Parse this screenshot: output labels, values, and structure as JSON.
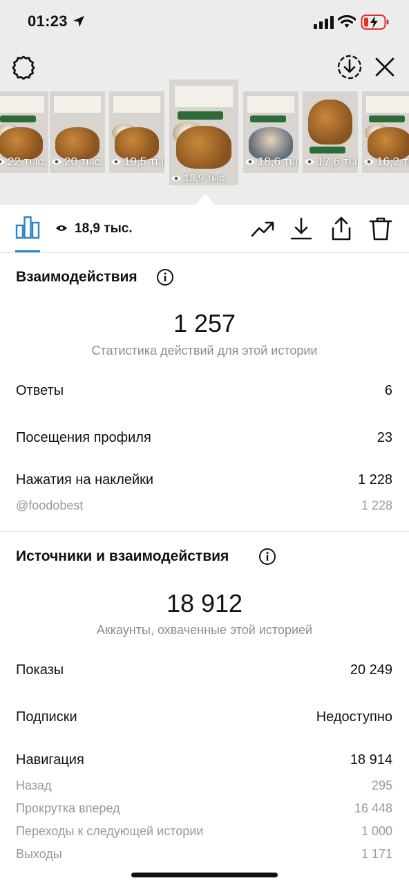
{
  "status_bar": {
    "time": "01:23"
  },
  "stories": [
    {
      "views": "22 тыс."
    },
    {
      "views": "20 тыс."
    },
    {
      "views": "19,5 тыс."
    },
    {
      "views": "18,9 тыс."
    },
    {
      "views": "18,6 тыс."
    },
    {
      "views": "17,6 тыс."
    },
    {
      "views": "16,2 тыс."
    }
  ],
  "toolbar": {
    "views_count": "18,9 тыс."
  },
  "interactions": {
    "title": "Взаимодействия",
    "total": "1 257",
    "caption": "Статистика действий для этой истории",
    "rows": [
      {
        "label": "Ответы",
        "value": "6"
      },
      {
        "label": "Посещения профиля",
        "value": "23"
      },
      {
        "label": "Нажатия на наклейки",
        "value": "1 228"
      }
    ],
    "sub_rows": [
      {
        "label": "@foodobest",
        "value": "1 228"
      }
    ]
  },
  "discovery": {
    "title": "Источники и взаимодействия",
    "total": "18 912",
    "caption": "Аккаунты, охваченные этой историей",
    "rows": [
      {
        "label": "Показы",
        "value": "20 249"
      },
      {
        "label": "Подписки",
        "value": "Недоступно"
      },
      {
        "label": "Навигация",
        "value": "18 914"
      }
    ],
    "navigation_details": [
      {
        "label": "Назад",
        "value": "295"
      },
      {
        "label": "Прокрутка вперед",
        "value": "16 448"
      },
      {
        "label": "Переходы к следующей истории",
        "value": "1 000"
      },
      {
        "label": "Выходы",
        "value": "1 171"
      }
    ]
  },
  "colors": {
    "accent": "#2b84c8",
    "secondary_text": "#8e8e8e",
    "battery_low": "#e0302e",
    "tag_green": "#2e6b38"
  }
}
